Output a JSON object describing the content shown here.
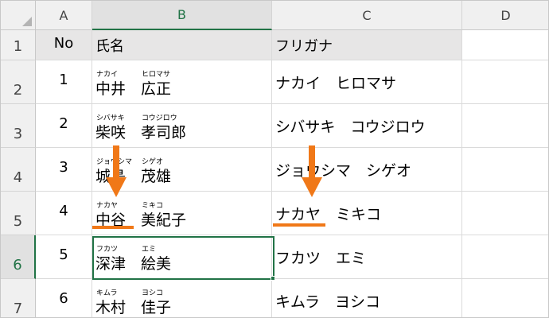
{
  "columns": [
    "A",
    "B",
    "C",
    "D"
  ],
  "rows": [
    "1",
    "2",
    "3",
    "4",
    "5",
    "6",
    "7"
  ],
  "header": {
    "no": "No",
    "name": "氏名",
    "furigana": "フリガナ"
  },
  "records": [
    {
      "no": "1",
      "sei": "中井",
      "mei": "広正",
      "sei_ruby": "ナカイ",
      "mei_ruby": "ヒロマサ",
      "furigana": "ナカイ　ヒロマサ"
    },
    {
      "no": "2",
      "sei": "柴咲",
      "mei": "孝司郎",
      "sei_ruby": "シバサキ",
      "mei_ruby": "コウジロウ",
      "furigana": "シバサキ　コウジロウ"
    },
    {
      "no": "3",
      "sei": "城島",
      "mei": "茂雄",
      "sei_ruby": "ジョウシマ",
      "mei_ruby": "シゲオ",
      "furigana": "ジョウシマ　シゲオ"
    },
    {
      "no": "4",
      "sei": "中谷",
      "mei": "美紀子",
      "sei_ruby": "ナカヤ",
      "mei_ruby": "ミキコ",
      "furigana": "ナカヤ　ミキコ"
    },
    {
      "no": "5",
      "sei": "深津",
      "mei": "絵美",
      "sei_ruby": "フカツ",
      "mei_ruby": "エミ",
      "furigana": "フカツ　エミ"
    },
    {
      "no": "6",
      "sei": "木村",
      "mei": "佳子",
      "sei_ruby": "キムラ",
      "mei_ruby": "ヨシコ",
      "furigana": "キムラ　ヨシコ"
    }
  ],
  "colors": {
    "selection": "#217346",
    "annotation": "#f07818",
    "header_fill": "#e7e6e6"
  },
  "icons": [
    "select-all-triangle-icon",
    "down-arrow-icon"
  ]
}
